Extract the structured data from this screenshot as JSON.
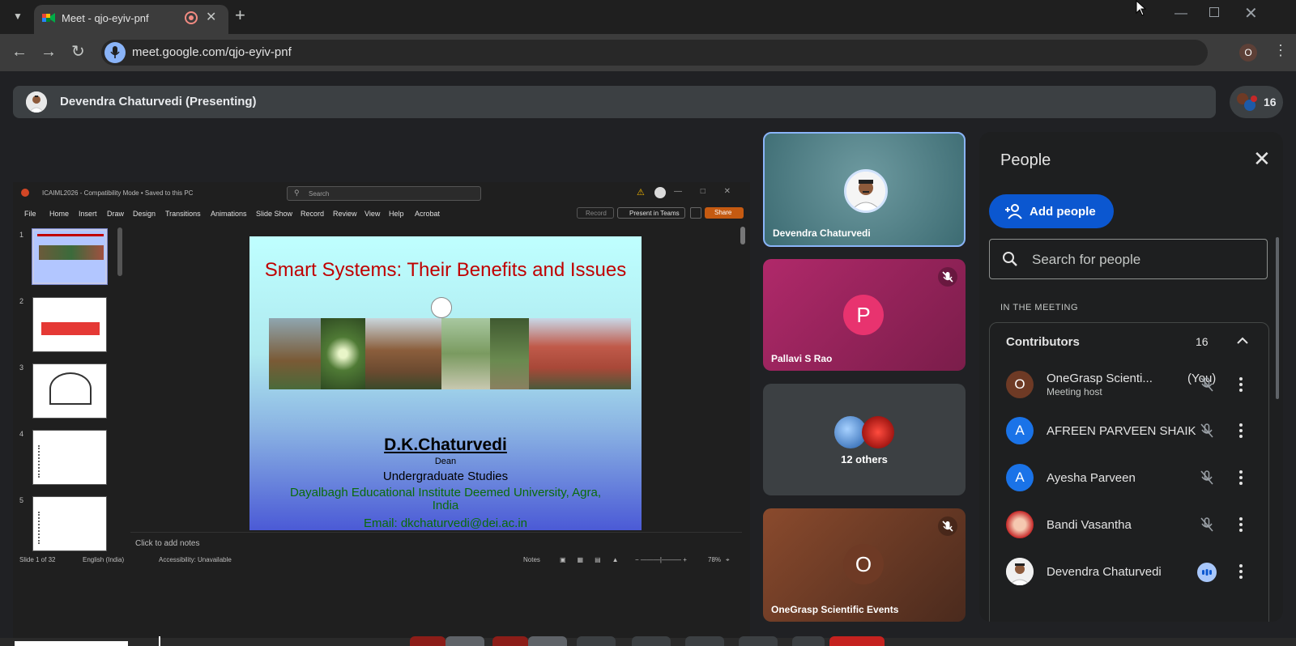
{
  "browser": {
    "tab_title": "Meet - qjo-eyiv-pnf",
    "url": "meet.google.com/qjo-eyiv-pnf",
    "profile_initial": "O"
  },
  "meet": {
    "presenting_label": "Devendra Chaturvedi (Presenting)",
    "participant_count": "16"
  },
  "presentation": {
    "doc_name": "ICAIML2026 - Compatibility Mode • Saved to this PC",
    "search_placeholder": "Search",
    "ribbon_tabs": [
      "File",
      "Home",
      "Insert",
      "Draw",
      "Design",
      "Transitions",
      "Animations",
      "Slide Show",
      "Record",
      "Review",
      "View",
      "Help",
      "Acrobat"
    ],
    "record_label": "Record",
    "present_in_teams_label": "Present in Teams",
    "share_label": "Share",
    "thumb_numbers": [
      "1",
      "2",
      "3",
      "4",
      "5"
    ],
    "slide": {
      "title": "Smart Systems: Their Benefits and Issues",
      "author": "D.K.Chaturvedi",
      "role": "Dean",
      "department": "Undergraduate Studies",
      "institute": "Dayalbagh Educational Institute Deemed University, Agra, India",
      "email": "Email: dkchaturvedi@dei.ac.in"
    },
    "notes_placeholder": "Click to add notes",
    "status": {
      "slide_of": "Slide 1 of 32",
      "language": "English (India)",
      "accessibility": "Accessibility: Unavailable",
      "notes_label": "Notes",
      "zoom": "78%"
    }
  },
  "tiles": [
    {
      "name": "Devendra Chaturvedi",
      "initial": ""
    },
    {
      "name": "Pallavi S Rao",
      "initial": "P"
    },
    {
      "name": "12 others",
      "initial": ""
    },
    {
      "name": "OneGrasp Scientific Events",
      "initial": "O"
    }
  ],
  "people_panel": {
    "title": "People",
    "add_people_label": "Add people",
    "search_placeholder": "Search for people",
    "section_label": "IN THE MEETING",
    "contributors_label": "Contributors",
    "contributors_count": "16",
    "participants": [
      {
        "name": "OneGrasp Scienti...",
        "you": "(You)",
        "subtitle": "Meeting host",
        "initial": "O",
        "color": "#6e3a25"
      },
      {
        "name": "AFREEN PARVEEN SHAIK",
        "initial": "A",
        "color": "#1a73e8"
      },
      {
        "name": "Ayesha Parveen",
        "initial": "A",
        "color": "#1a73e8"
      },
      {
        "name": "Bandi Vasantha",
        "initial": "",
        "color": "#c62828"
      },
      {
        "name": "Devendra Chaturvedi",
        "initial": "",
        "color": "#e0e0e0"
      }
    ]
  },
  "colors": {
    "accent": "#8ab4f8",
    "add_people_button": "#0b57d0",
    "slide_title": "#c00000",
    "slide_green_text": "#0a6b0a"
  }
}
